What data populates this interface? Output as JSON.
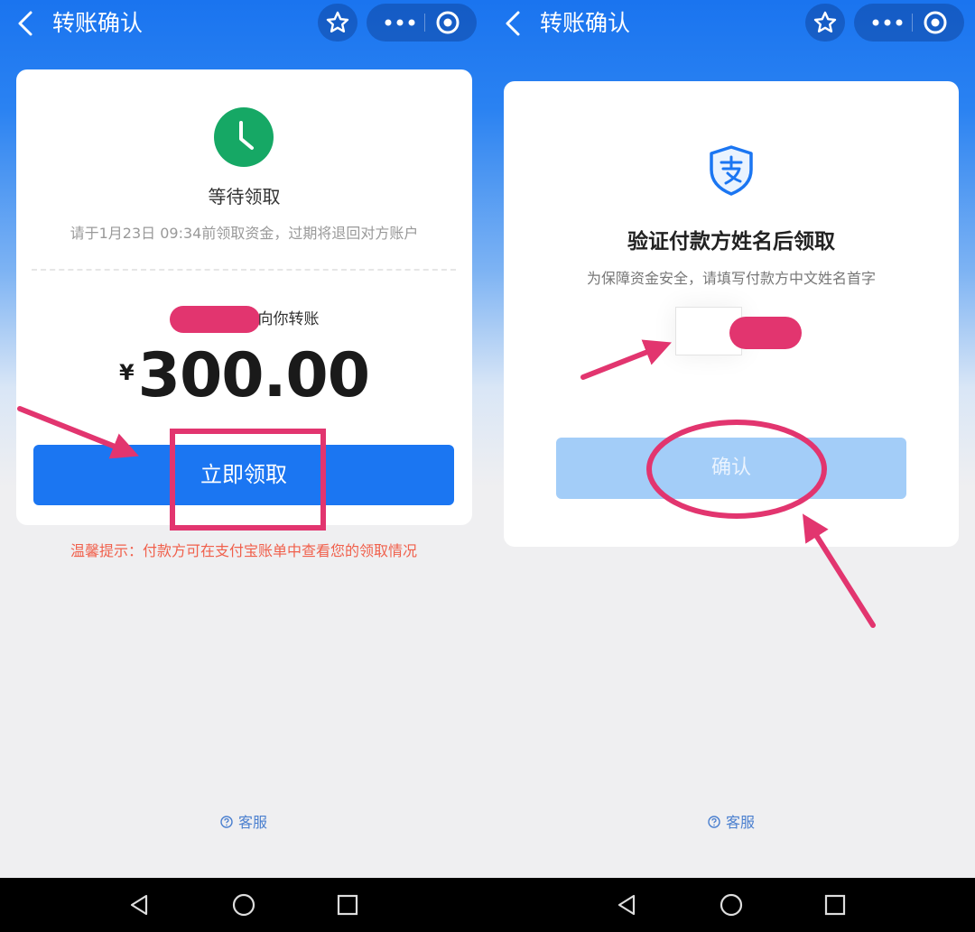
{
  "colors": {
    "brand_blue": "#1b76f2",
    "wait_green": "#16a865",
    "annotation_pink": "#e2356f",
    "tip_red": "#f0604c",
    "link_blue": "#4a7fcf"
  },
  "left_screen": {
    "title": "转账确认",
    "status_icon": "clock-icon",
    "status_title": "等待领取",
    "deadline_text": "请于1月23日 09:34前领取资金，过期将退回对方账户",
    "sender_suffix": "向你转账",
    "currency_symbol": "¥",
    "amount": "300.00",
    "claim_button_label": "立即领取",
    "tip_text": "温馨提示：付款方可在支付宝账单中查看您的领取情况",
    "service_label": "客服"
  },
  "right_screen": {
    "title": "转账确认",
    "shield_icon": "alipay-shield-icon",
    "verify_title": "验证付款方姓名后领取",
    "verify_desc": "为保障资金安全，请填写付款方中文姓名首字",
    "name_input_value": "",
    "confirm_button_label": "确认",
    "service_label": "客服"
  },
  "nav_icons": [
    "back-triangle-icon",
    "home-circle-icon",
    "recents-square-icon"
  ]
}
